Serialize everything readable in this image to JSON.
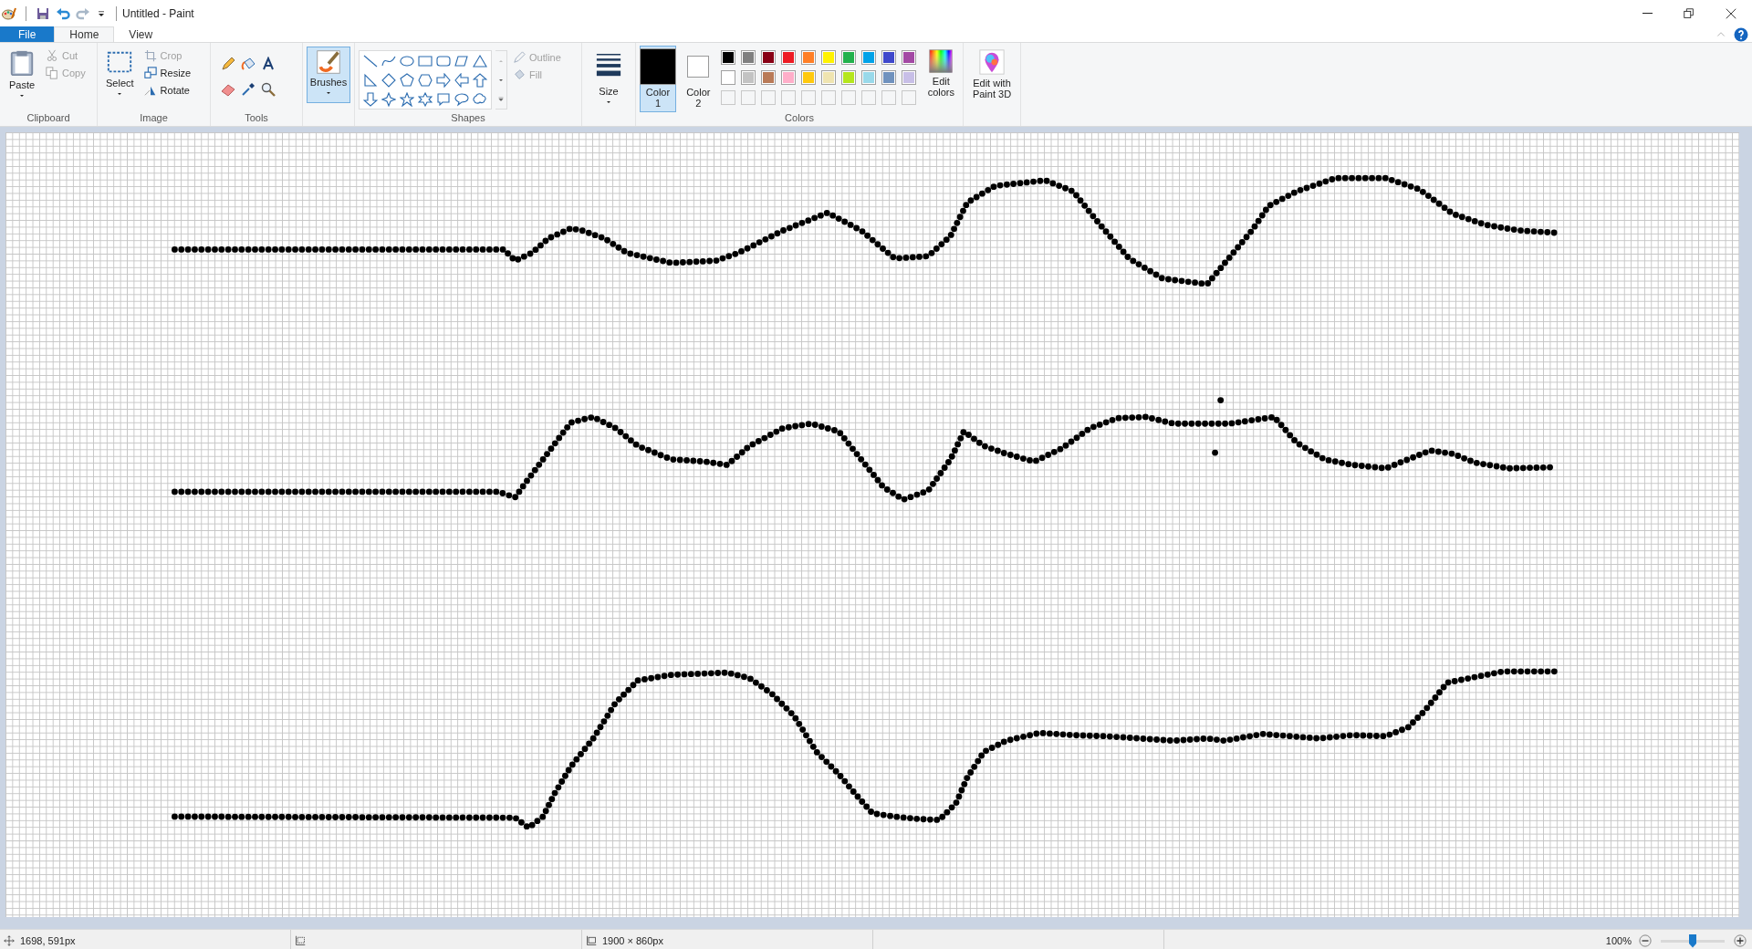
{
  "window": {
    "title": "Untitled - Paint"
  },
  "tabs": [
    {
      "label": "File",
      "kind": "file",
      "selected": false
    },
    {
      "label": "Home",
      "kind": "tab",
      "selected": true
    },
    {
      "label": "View",
      "kind": "tab",
      "selected": false
    }
  ],
  "clipboard": {
    "label": "Clipboard",
    "paste": "Paste",
    "cut": {
      "label": "Cut",
      "disabled": true
    },
    "copy": {
      "label": "Copy",
      "disabled": true
    }
  },
  "image": {
    "label": "Image",
    "select": "Select",
    "crop": {
      "label": "Crop",
      "disabled": true
    },
    "resize": {
      "label": "Resize",
      "disabled": false
    },
    "rotate": {
      "label": "Rotate",
      "disabled": false
    }
  },
  "tools": {
    "label": "Tools"
  },
  "brushes": {
    "label": "Brushes",
    "selected": true
  },
  "shapes": {
    "label": "Shapes",
    "outline": {
      "label": "Outline",
      "disabled": true
    },
    "fill": {
      "label": "Fill",
      "disabled": true
    }
  },
  "size": {
    "label": "Size"
  },
  "colors": {
    "label": "Colors",
    "color1": {
      "label": "Color\n1",
      "color": "#000000",
      "selected": true
    },
    "color2": {
      "label": "Color\n2",
      "color": "#ffffff",
      "selected": false
    },
    "palette": [
      {
        "kind": "swatch",
        "color": "#000000"
      },
      {
        "kind": "swatch",
        "color": "#7f7f7f"
      },
      {
        "kind": "swatch",
        "color": "#880015"
      },
      {
        "kind": "swatch",
        "color": "#ed1c24"
      },
      {
        "kind": "swatch",
        "color": "#ff7f27"
      },
      {
        "kind": "swatch",
        "color": "#fff200"
      },
      {
        "kind": "swatch",
        "color": "#22b14c"
      },
      {
        "kind": "swatch",
        "color": "#00a2e8"
      },
      {
        "kind": "swatch",
        "color": "#3f48cc"
      },
      {
        "kind": "swatch",
        "color": "#a349a4"
      },
      {
        "kind": "swatch",
        "color": "#ffffff"
      },
      {
        "kind": "swatch",
        "color": "#c3c3c3"
      },
      {
        "kind": "swatch",
        "color": "#b97a57"
      },
      {
        "kind": "swatch",
        "color": "#ffaec9"
      },
      {
        "kind": "swatch",
        "color": "#ffc90e"
      },
      {
        "kind": "swatch",
        "color": "#efe4b0"
      },
      {
        "kind": "swatch",
        "color": "#b5e61d"
      },
      {
        "kind": "swatch",
        "color": "#99d9ea"
      },
      {
        "kind": "swatch",
        "color": "#7092be"
      },
      {
        "kind": "swatch",
        "color": "#c8bfe7"
      },
      {
        "kind": "empty"
      },
      {
        "kind": "empty"
      },
      {
        "kind": "empty"
      },
      {
        "kind": "empty"
      },
      {
        "kind": "empty"
      },
      {
        "kind": "empty"
      },
      {
        "kind": "empty"
      },
      {
        "kind": "empty"
      },
      {
        "kind": "empty"
      },
      {
        "kind": "empty"
      }
    ],
    "edit_colors": "Edit\ncolors"
  },
  "paint3d": "Edit with\nPaint 3D",
  "status_bar": {
    "cursor": "1698, 591px",
    "canvas_size": "1900 × 860px",
    "zoom": "100%",
    "zoom_level": {
      "level": 0.5
    }
  }
}
